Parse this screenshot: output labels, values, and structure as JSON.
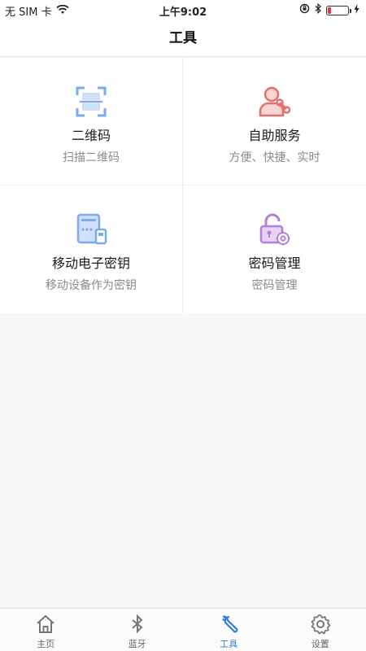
{
  "status_bar": {
    "carrier": "无 SIM 卡",
    "time": "上午9:02",
    "battery_level": 0.18
  },
  "nav": {
    "title": "工具"
  },
  "tools": [
    {
      "title": "二维码",
      "subtitle": "扫描二维码",
      "icon": "qr-scan-icon",
      "color": "#7ea9ea"
    },
    {
      "title": "自助服务",
      "subtitle": "方便、快捷、实时",
      "icon": "self-service-icon",
      "color": "#e0736f"
    },
    {
      "title": "移动电子密钥",
      "subtitle": "移动设备作为密钥",
      "icon": "mobile-key-icon",
      "color": "#7ea9ea"
    },
    {
      "title": "密码管理",
      "subtitle": "密码管理",
      "icon": "password-lock-icon",
      "color": "#b57edc"
    }
  ],
  "tabs": [
    {
      "label": "主页",
      "icon": "home-icon",
      "active": false
    },
    {
      "label": "蓝牙",
      "icon": "bluetooth-icon",
      "active": false
    },
    {
      "label": "工具",
      "icon": "wrench-icon",
      "active": true
    },
    {
      "label": "设置",
      "icon": "gear-icon",
      "active": false
    }
  ],
  "colors": {
    "accent": "#2e7de0",
    "inactive": "#666666"
  }
}
